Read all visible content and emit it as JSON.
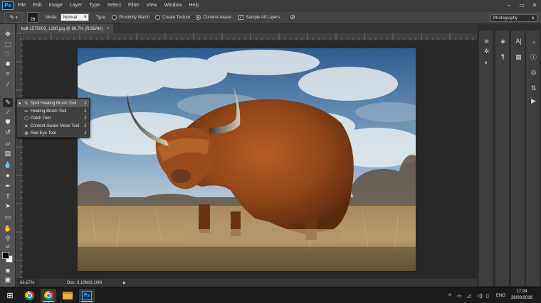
{
  "app": {
    "logo": "Ps"
  },
  "menu": [
    "File",
    "Edit",
    "Image",
    "Layer",
    "Type",
    "Select",
    "Filter",
    "View",
    "Window",
    "Help"
  ],
  "window_controls": [
    "–",
    "▭",
    "✕"
  ],
  "options": {
    "brush_size": "28",
    "mode_label": "Mode:",
    "mode_value": "Normal",
    "type_label": "Type:",
    "radio_proximity": "Proximity Match",
    "radio_texture": "Create Texture",
    "radio_content": "Content-Aware",
    "sample_all_layers": "Sample All Layers",
    "workspace": "Photography"
  },
  "document": {
    "tab_title": "bull-1575003_1280.jpg @ 66.7% (RGB/8#)",
    "tab_close": "×"
  },
  "status": {
    "zoom": "66.67%",
    "doc_size": "Doc: 3.10M/3.10M",
    "arrow": "▶"
  },
  "tool_flyout": {
    "items": [
      {
        "label": "Spot Healing Brush Tool",
        "key": "J",
        "icon": "spot-healing-icon",
        "selected": true
      },
      {
        "label": "Healing Brush Tool",
        "key": "J",
        "icon": "healing-brush-icon",
        "selected": false
      },
      {
        "label": "Patch Tool",
        "key": "J",
        "icon": "patch-icon",
        "selected": false
      },
      {
        "label": "Content-Aware Move Tool",
        "key": "J",
        "icon": "content-aware-move-icon",
        "selected": false
      },
      {
        "label": "Red Eye Tool",
        "key": "J",
        "icon": "red-eye-icon",
        "selected": false
      }
    ]
  },
  "taskbar": {
    "language": "ENG",
    "time": "17:24",
    "date": "26/08/2016"
  },
  "colors": {
    "foreground": "#000000",
    "background": "#ffffff",
    "accent": "#31a8ff"
  }
}
